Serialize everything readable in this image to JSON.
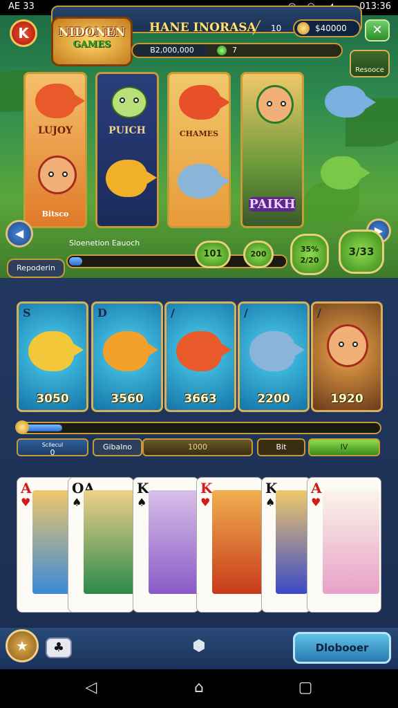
{
  "status_bar": {
    "carrier": "AE 33",
    "clock": "013:36"
  },
  "header": {
    "logo_line1": "NIDONEN",
    "logo_line2": "GAMES",
    "game_name": "HANE INORASA",
    "small_value": "10",
    "coins": "$40000",
    "progress_text": "B2,000,000",
    "gem_count": "7",
    "side_button_label": "Resooce"
  },
  "hero_cards": [
    {
      "label": "LUJOY",
      "footer": "Bitsco"
    },
    {
      "label": "PUICH"
    },
    {
      "label": "CHAMES"
    },
    {
      "label": "PAIKH"
    }
  ],
  "left_bar": {
    "caption": "Sloenetion Eauoch",
    "button": "Repoderin",
    "progress": 0.06
  },
  "round_buttons": [
    "101",
    "200",
    "35%\n2/20",
    "3/33"
  ],
  "fish_cards": [
    {
      "corner": "S",
      "value": "3050"
    },
    {
      "corner": "D",
      "value": "3560"
    },
    {
      "corner": "/",
      "value": "3663"
    },
    {
      "corner": "/",
      "value": "2200"
    },
    {
      "corner": "/",
      "value": "1920"
    }
  ],
  "long_progress": 0.12,
  "stats": [
    {
      "label": "0",
      "sub": "Scllecul"
    },
    {
      "label": "Gibalno"
    },
    {
      "label": "1000"
    },
    {
      "label": "Bit"
    },
    {
      "label": "IV"
    }
  ],
  "play_cards": [
    {
      "rank": "A",
      "suit": "♥",
      "color": "red"
    },
    {
      "rank": "OA",
      "suit": "♠",
      "color": "black"
    },
    {
      "rank": "K",
      "suit": "♠",
      "color": "black"
    },
    {
      "rank": "K",
      "suit": "♥",
      "color": "red"
    },
    {
      "rank": "K",
      "suit": "♠",
      "color": "black"
    },
    {
      "rank": "A",
      "suit": "♥",
      "color": "red"
    }
  ],
  "bottom": {
    "discover_label": "Dlobooer"
  },
  "colors": {
    "gold": "#c79a3a",
    "navy": "#1b2e50",
    "green": "#3a8a1a"
  }
}
